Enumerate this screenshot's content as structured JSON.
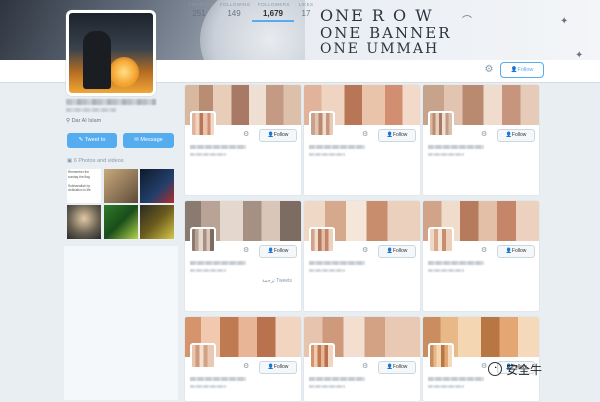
{
  "banner": {
    "slogan": [
      "ONE R O W",
      "ONE BANNER",
      "ONE UMMAH"
    ]
  },
  "stats": [
    {
      "label": "TWEETS",
      "value": "251",
      "active": false
    },
    {
      "label": "FOLLOWING",
      "value": "149",
      "active": false
    },
    {
      "label": "FOLLOWERS",
      "value": "1,679",
      "active": true
    },
    {
      "label": "LIKES",
      "value": "17",
      "active": false
    }
  ],
  "profile_actions": {
    "follow_label": "Follow",
    "gear_icon": "gear-icon"
  },
  "profile": {
    "location": "Dar Al Islam",
    "tweet_to_label": "Tweet to",
    "message_label": "Message",
    "photos_label": "6 Photos and videos",
    "thumb_text": "Remember the\nsunday the flag\n\nSubhanallah by\ncivilization is life"
  },
  "cards": [
    {
      "follow_label": "Follow"
    },
    {
      "follow_label": "Follow"
    },
    {
      "follow_label": "Follow"
    },
    {
      "follow_label": "Follow"
    },
    {
      "follow_label": "Follow"
    },
    {
      "follow_label": "Follow"
    },
    {
      "follow_label": "Follow"
    },
    {
      "follow_label": "Follow"
    },
    {
      "follow_label": "Follow"
    }
  ],
  "translate_link": "ترجمة Tweets",
  "watermark": {
    "text": "安全牛"
  },
  "colors": {
    "accent": "#55acee",
    "background": "#e9eef3"
  }
}
